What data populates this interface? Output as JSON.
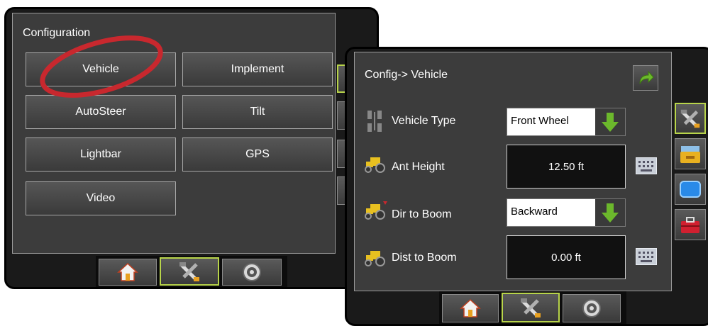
{
  "config_screen": {
    "title": "Configuration",
    "buttons": [
      "Vehicle",
      "Implement",
      "AutoSteer",
      "Tilt",
      "Lightbar",
      "GPS",
      "Video"
    ],
    "nav": {
      "home_icon": "home-icon",
      "tools_icon": "tools-icon",
      "gauge_icon": "speedometer-icon"
    }
  },
  "vehicle_screen": {
    "title": "Config-> Vehicle",
    "rows": [
      {
        "label": "Vehicle Type",
        "value": "Front Wheel",
        "control": "dropdown",
        "icon": "steering-axle-icon"
      },
      {
        "label": "Ant Height",
        "value": "12.50 ft",
        "control": "keyboard",
        "icon": "tractor-icon"
      },
      {
        "label": "Dir to Boom",
        "value": "Backward",
        "control": "dropdown",
        "icon": "tractor-direction-icon"
      },
      {
        "label": "Dist to Boom",
        "value": "0.00 ft",
        "control": "keyboard",
        "icon": "tractor-distance-icon"
      }
    ],
    "side_tabs": [
      "tools-icon",
      "data-folder-icon",
      "display-icon",
      "toolbox-icon"
    ]
  },
  "colors": {
    "highlight_circle": "#c8282e",
    "active_border": "#b8d44a",
    "arrow_green": "#6cb82c"
  }
}
